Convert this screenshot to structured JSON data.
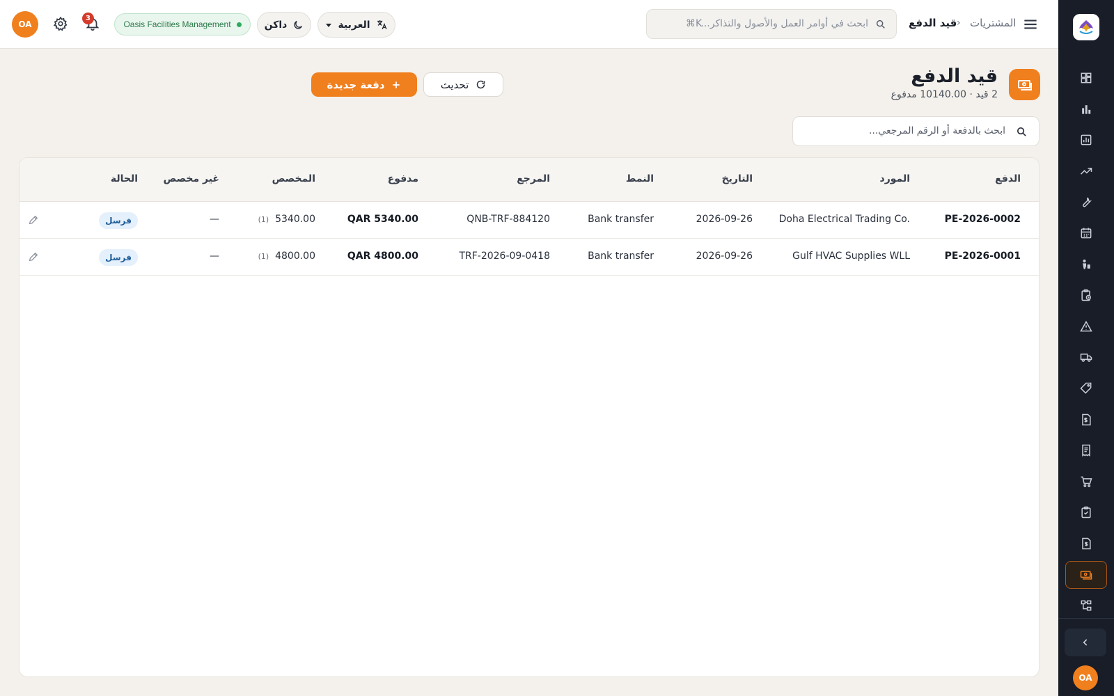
{
  "header": {
    "breadcrumb_parent": "المشتريات",
    "breadcrumb_current": "قيد الدفع",
    "search_placeholder": "ابحث في أوامر العمل والأصول والتذاكر...",
    "search_shortcut": "⌘K",
    "language": "العربية",
    "theme": "داكن",
    "org_name": "Oasis Facilities Management",
    "notification_count": "3",
    "user_initials": "OA"
  },
  "page": {
    "title": "قيد الدفع",
    "subtitle": "2 قيد · 10140.00 مدفوع",
    "refresh_label": "تحديث",
    "new_label": "دفعة جديدة",
    "search_placeholder": "ابحث بالدفعة أو الرقم المرجعي..."
  },
  "table": {
    "columns": {
      "payment": "الدفع",
      "supplier": "المورد",
      "date": "التاريخ",
      "mode": "النمط",
      "reference": "المرجع",
      "paid": "مدفوع",
      "allocated": "المخصص",
      "unallocated": "غير مخصص",
      "status": "الحالة"
    },
    "rows": [
      {
        "payment": "PE-2026-0002",
        "supplier": "Doha Electrical Trading Co.",
        "date": "2026-09-26",
        "mode": "Bank transfer",
        "reference": "QNB-TRF-884120",
        "paid": "QAR 5340.00",
        "allocated": "5340.00",
        "allocated_count": "(1)",
        "unallocated": "—",
        "status": "فرسل"
      },
      {
        "payment": "PE-2026-0001",
        "supplier": "Gulf HVAC Supplies WLL",
        "date": "2026-09-26",
        "mode": "Bank transfer",
        "reference": "TRF-2026-09-0418",
        "paid": "QAR 4800.00",
        "allocated": "4800.00",
        "allocated_count": "(1)",
        "unallocated": "—",
        "status": "فرسل"
      }
    ]
  },
  "sidebar": {
    "user_initials": "OA",
    "items": [
      {
        "icon": "dashboard-icon"
      },
      {
        "icon": "bar-chart-icon"
      },
      {
        "icon": "report-icon"
      },
      {
        "icon": "trend-icon"
      },
      {
        "icon": "wrench-icon"
      },
      {
        "icon": "calendar-icon"
      },
      {
        "icon": "technician-icon"
      },
      {
        "icon": "clipboard-clock-icon"
      },
      {
        "icon": "warning-icon"
      },
      {
        "icon": "truck-icon"
      },
      {
        "icon": "tag-icon"
      },
      {
        "icon": "invoice-icon"
      },
      {
        "icon": "receipt-icon"
      },
      {
        "icon": "cart-icon"
      },
      {
        "icon": "clipboard-check-icon"
      },
      {
        "icon": "document-dollar-icon"
      },
      {
        "icon": "payment-entry-icon"
      },
      {
        "icon": "flow-icon"
      }
    ]
  },
  "colors": {
    "accent": "#f07f1e",
    "sidebar_bg": "#181d27",
    "status_badge_bg": "#e4f0fb",
    "org_pill_green": "#2eaa5c"
  }
}
